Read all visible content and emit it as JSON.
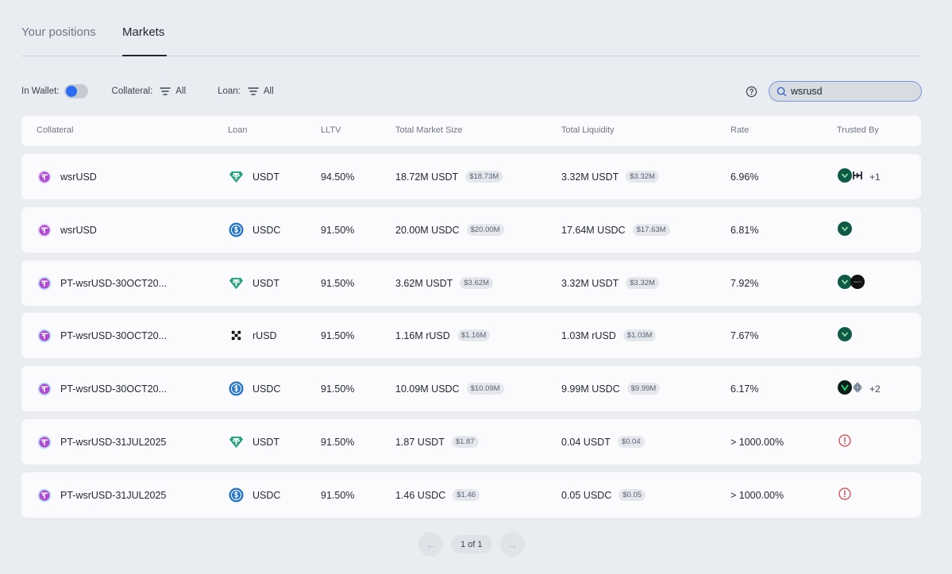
{
  "tabs": [
    {
      "label": "Your positions"
    },
    {
      "label": "Markets"
    }
  ],
  "filters": {
    "wallet_label": "In Wallet:",
    "collateral_label": "Collateral:",
    "collateral_value": "All",
    "loan_label": "Loan:",
    "loan_value": "All"
  },
  "search": {
    "value": "wsrusd"
  },
  "columns": [
    "Collateral",
    "Loan",
    "LLTV",
    "Total Market Size",
    "Total Liquidity",
    "Rate",
    "Trusted By"
  ],
  "rows": [
    {
      "collateral": "wsrUSD",
      "loan": "USDT",
      "loan_icon": "tether-icon",
      "lltv": "94.50%",
      "size": "18.72M USDT",
      "size_usd": "$18.73M",
      "liquidity": "3.32M USDT",
      "liquidity_usd": "$3.32M",
      "rate": "6.96%",
      "trusted": [
        "vault-green-icon",
        "vault-bars-icon"
      ],
      "trusted_more": "+1"
    },
    {
      "collateral": "wsrUSD",
      "loan": "USDC",
      "loan_icon": "usdc-icon",
      "lltv": "91.50%",
      "size": "20.00M USDC",
      "size_usd": "$20.00M",
      "liquidity": "17.64M USDC",
      "liquidity_usd": "$17.63M",
      "rate": "6.81%",
      "trusted": [
        "vault-green-icon"
      ],
      "trusted_more": ""
    },
    {
      "collateral": "PT-wsrUSD-30OCT20...",
      "loan": "USDT",
      "loan_icon": "tether-icon",
      "lltv": "91.50%",
      "size": "3.62M USDT",
      "size_usd": "$3.62M",
      "liquidity": "3.32M USDT",
      "liquidity_usd": "$3.32M",
      "rate": "7.92%",
      "trusted": [
        "vault-green-icon",
        "vault-black-icon"
      ],
      "trusted_more": ""
    },
    {
      "collateral": "PT-wsrUSD-30OCT20...",
      "loan": "rUSD",
      "loan_icon": "rusd-icon",
      "lltv": "91.50%",
      "size": "1.16M rUSD",
      "size_usd": "$1.16M",
      "liquidity": "1.03M rUSD",
      "liquidity_usd": "$1.03M",
      "rate": "7.67%",
      "trusted": [
        "vault-green-icon"
      ],
      "trusted_more": ""
    },
    {
      "collateral": "PT-wsrUSD-30OCT20...",
      "loan": "USDC",
      "loan_icon": "usdc-icon",
      "lltv": "91.50%",
      "size": "10.09M USDC",
      "size_usd": "$10.09M",
      "liquidity": "9.99M USDC",
      "liquidity_usd": "$9.99M",
      "rate": "6.17%",
      "trusted": [
        "vault-dark-green-icon",
        "diamond-icon"
      ],
      "trusted_more": "+2"
    },
    {
      "collateral": "PT-wsrUSD-31JUL2025",
      "loan": "USDT",
      "loan_icon": "tether-icon",
      "lltv": "91.50%",
      "size": "1.87 USDT",
      "size_usd": "$1.87",
      "liquidity": "0.04 USDT",
      "liquidity_usd": "$0.04",
      "rate": "> 1000.00%",
      "trusted": [
        "warning-icon"
      ],
      "trusted_more": ""
    },
    {
      "collateral": "PT-wsrUSD-31JUL2025",
      "loan": "USDC",
      "loan_icon": "usdc-icon",
      "lltv": "91.50%",
      "size": "1.46 USDC",
      "size_usd": "$1.46",
      "liquidity": "0.05 USDC",
      "liquidity_usd": "$0.05",
      "rate": "> 1000.00%",
      "trusted": [
        "warning-icon"
      ],
      "trusted_more": ""
    }
  ],
  "pagination": {
    "label": "1 of 1"
  },
  "colors": {
    "accent": "#2a6df4",
    "tether": "#26a17b",
    "usdc": "#2775ca",
    "vault": "#0f5a44",
    "warning": "#d2434b",
    "wsrusd": "#b04bd6"
  }
}
